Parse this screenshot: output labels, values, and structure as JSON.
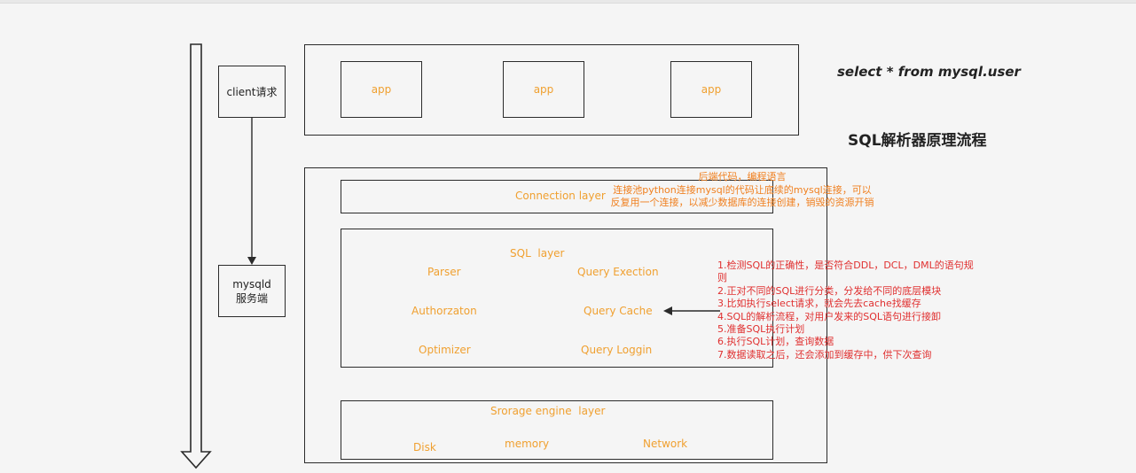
{
  "top_query": "select * from mysql.user",
  "diagram_title": "SQL解析器原理流程",
  "client": {
    "label": "client请求"
  },
  "server": {
    "label": "mysqld\n服务端"
  },
  "apps": [
    "app",
    "app",
    "app"
  ],
  "connection_layer": {
    "label": "Connection layer",
    "note": "后端代码，编程语言\n连接池python连接mysql的代码让底续的mysql连接，可以\n反复用一个连接，以减少数据库的连接创建，销毁的资源开销"
  },
  "sql_layer": {
    "label": "SQL  layer",
    "items": [
      "Parser",
      "Query Exection",
      "Authorzaton",
      "Query Cache",
      "Optimizer",
      "Query Loggin"
    ],
    "notes": "1.检测SQL的正确性，是否符合DDL，DCL，DML的语句规\n则\n2.正对不同的SQL进行分类，分发给不同的底层模块\n3.比如执行select请求，就会先去cache找缓存\n4.SQL的解析流程，对用户发来的SQL语句进行接卸\n5.准备SQL执行计划\n6.执行SQL计划，查询数据\n7.数据读取之后，还会添加到缓存中，供下次查询"
  },
  "storage_layer": {
    "label": "Srorage engine  layer",
    "items": [
      "Disk",
      "memory",
      "Network"
    ]
  },
  "colors": {
    "orange": "#f0a030",
    "red": "#e03030",
    "stroke": "#2b2b2b"
  }
}
